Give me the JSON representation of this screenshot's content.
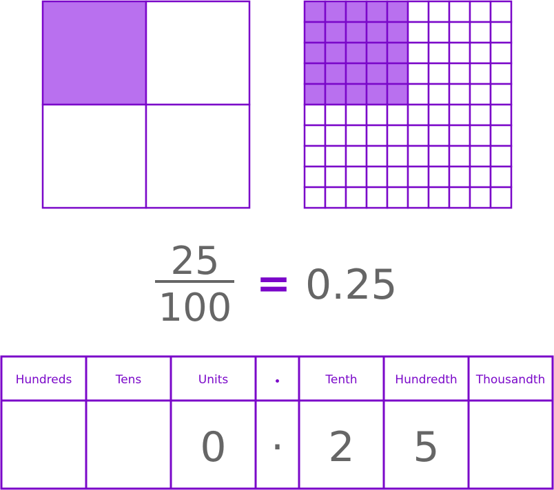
{
  "colors": {
    "stroke": "#7a07c9",
    "fill": "#b970ef",
    "text": "#666666",
    "equals": "#7a07c9"
  },
  "quarter_model": {
    "divisions": 4,
    "shaded": 1
  },
  "hundred_grid": {
    "rows": 10,
    "cols": 10,
    "shaded_rows": 5,
    "shaded_cols": 5
  },
  "equation": {
    "numerator": "25",
    "denominator": "100",
    "equals": "=",
    "decimal": "0.25"
  },
  "place_value_table": {
    "headers": [
      "Hundreds",
      "Tens",
      "Units",
      "•",
      "Tenth",
      "Hundredth",
      "Thousandth"
    ],
    "values": [
      "",
      "",
      "0",
      "·",
      "2",
      "5",
      ""
    ]
  }
}
